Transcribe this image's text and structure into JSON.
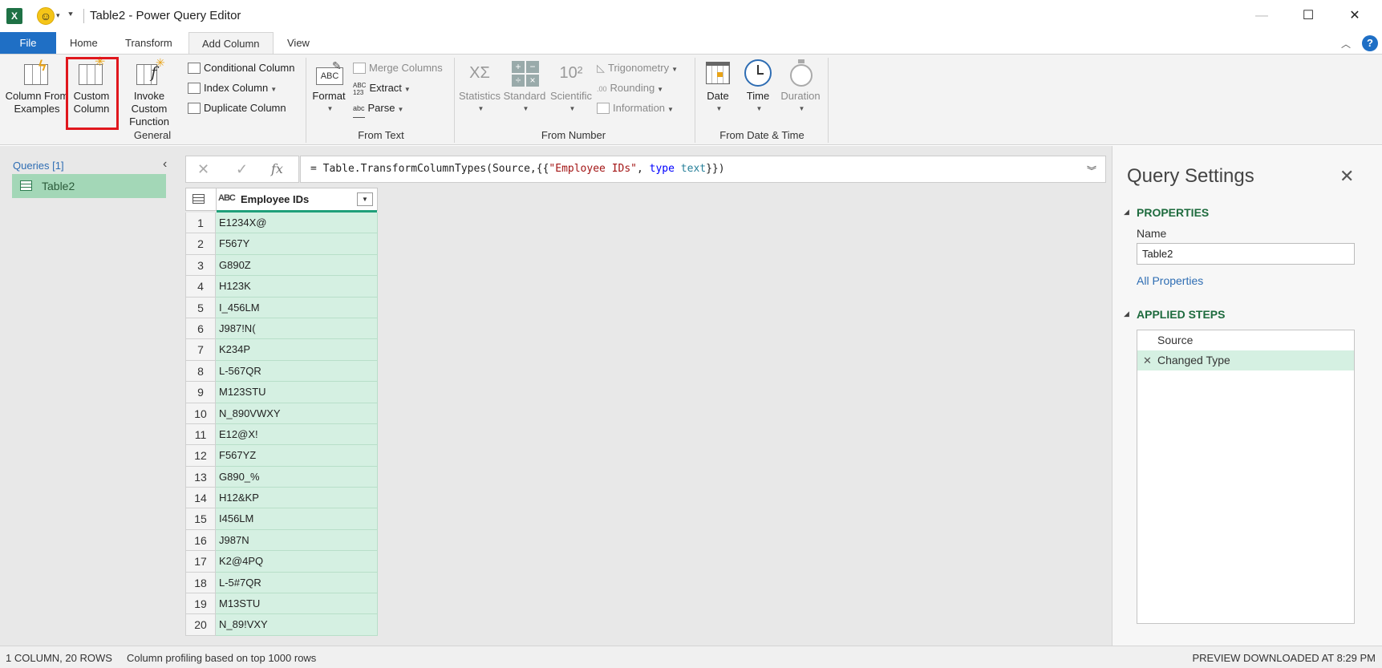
{
  "titlebar": {
    "app_icon": "X",
    "title": "Table2 - Power Query Editor",
    "icons": [
      "excel-icon",
      "smiley-icon",
      "customize-quick-access-icon",
      "minimize-icon",
      "maximize-icon",
      "close-icon"
    ]
  },
  "tabs": {
    "file": "File",
    "home": "Home",
    "transform": "Transform",
    "add_column": "Add Column",
    "view": "View",
    "help": "?"
  },
  "ribbon": {
    "general": {
      "label": "General",
      "column_from_examples": "Column From\nExamples",
      "custom_column_l1": "Custom",
      "custom_column_l2": "Column",
      "invoke_l1": "Invoke Custom",
      "invoke_l2": "Function",
      "conditional_column": "Conditional Column",
      "index_column": "Index Column",
      "duplicate_column": "Duplicate Column"
    },
    "from_text": {
      "label": "From Text",
      "format": "Format",
      "merge_columns": "Merge Columns",
      "extract": "Extract",
      "parse": "Parse",
      "format_icon_text": "ABC",
      "extract_icon_text_top": "ABC",
      "extract_icon_text_bottom": "123",
      "parse_icon_text": "abc"
    },
    "from_number": {
      "label": "From Number",
      "statistics": "Statistics",
      "standard": "Standard",
      "scientific": "Scientific",
      "trigonometry": "Trigonometry",
      "rounding": "Rounding",
      "information": "Information",
      "stats_icon_text": "XΣ",
      "sci_icon_text": "10²",
      "round_icon_text": ".00"
    },
    "from_date_time": {
      "label": "From Date & Time",
      "date": "Date",
      "time": "Time",
      "duration": "Duration"
    }
  },
  "queries": {
    "title": "Queries [1]",
    "items": [
      {
        "label": "Table2"
      }
    ]
  },
  "formula_bar": {
    "prefix": "= Table.TransformColumnTypes(Source,{{",
    "string": "\"Employee IDs\"",
    "sep": ", ",
    "kw": "type",
    "space": " ",
    "typ": "text",
    "suffix": "}})"
  },
  "grid": {
    "column_type": "ABC",
    "column_name": "Employee IDs",
    "rows": [
      "E1234X@",
      "F567Y",
      "G890Z",
      "H123K",
      "I_456LM",
      "J987!N(",
      "K234P",
      "L-567QR",
      "M123STU",
      "N_890VWXY",
      "E12@X!",
      "F567YZ",
      "G890_%",
      "H12&KP",
      "I456LM",
      "J987N",
      "K2@4PQ",
      "L-5#7QR",
      "M13STU",
      "N_89!VXY"
    ]
  },
  "settings": {
    "title": "Query Settings",
    "properties_title": "PROPERTIES",
    "name_label": "Name",
    "name_value": "Table2",
    "all_properties": "All Properties",
    "applied_steps_title": "APPLIED STEPS",
    "steps": [
      "Source",
      "Changed Type"
    ]
  },
  "status": {
    "columns_rows": "1 COLUMN, 20 ROWS",
    "profiling": "Column profiling based on top 1000 rows",
    "preview": "PREVIEW DOWNLOADED AT 8:29 PM"
  }
}
